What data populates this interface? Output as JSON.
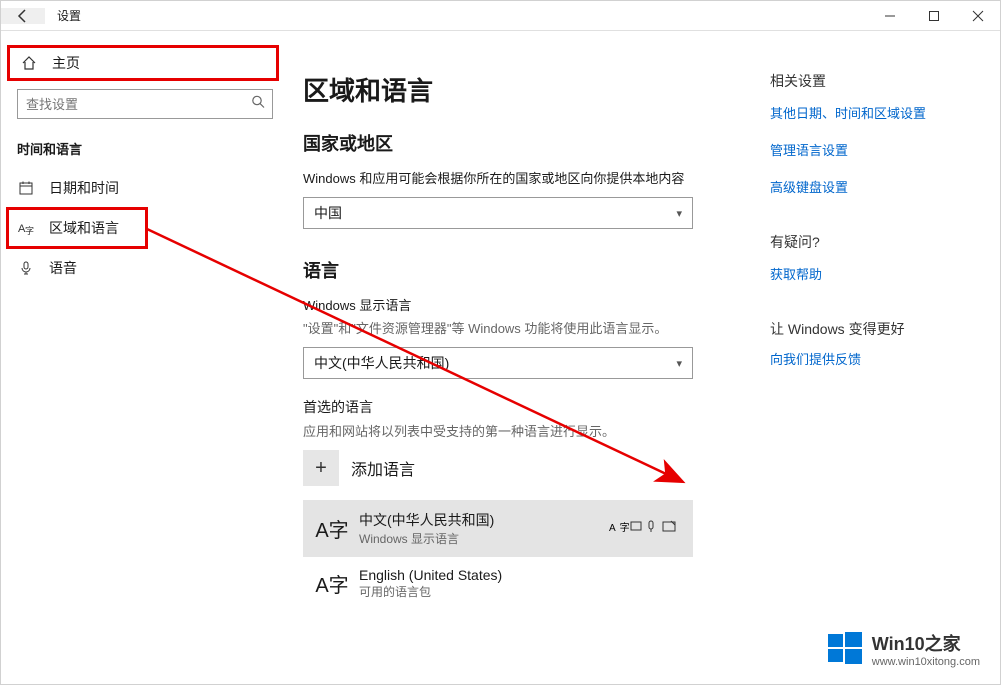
{
  "titlebar": {
    "title": "设置"
  },
  "sidebar": {
    "home": "主页",
    "search_placeholder": "查找设置",
    "group_title": "时间和语言",
    "items": [
      {
        "label": "日期和时间"
      },
      {
        "label": "区域和语言"
      },
      {
        "label": "语音"
      }
    ]
  },
  "main": {
    "page_title": "区域和语言",
    "region": {
      "heading": "国家或地区",
      "desc": "Windows 和应用可能会根据你所在的国家或地区向你提供本地内容",
      "value": "中国"
    },
    "language": {
      "heading": "语言",
      "display_label": "Windows 显示语言",
      "display_desc": "\"设置\"和\"文件资源管理器\"等 Windows 功能将使用此语言显示。",
      "display_value": "中文(中华人民共和国)",
      "preferred_heading": "首选的语言",
      "preferred_desc": "应用和网站将以列表中受支持的第一种语言进行显示。",
      "add_label": "添加语言",
      "items": [
        {
          "glyph": "A字",
          "name": "中文(中华人民共和国)",
          "sub": "Windows 显示语言"
        },
        {
          "glyph": "A字",
          "name": "English (United States)",
          "sub": "可用的语言包"
        }
      ]
    }
  },
  "right": {
    "related_heading": "相关设置",
    "related_links": [
      "其他日期、时间和区域设置",
      "管理语言设置",
      "高级键盘设置"
    ],
    "help_heading": "有疑问?",
    "help_link": "获取帮助",
    "feedback_heading": "让 Windows 变得更好",
    "feedback_link": "向我们提供反馈"
  },
  "branding": {
    "title": "Win10之家",
    "url": "www.win10xitong.com"
  }
}
